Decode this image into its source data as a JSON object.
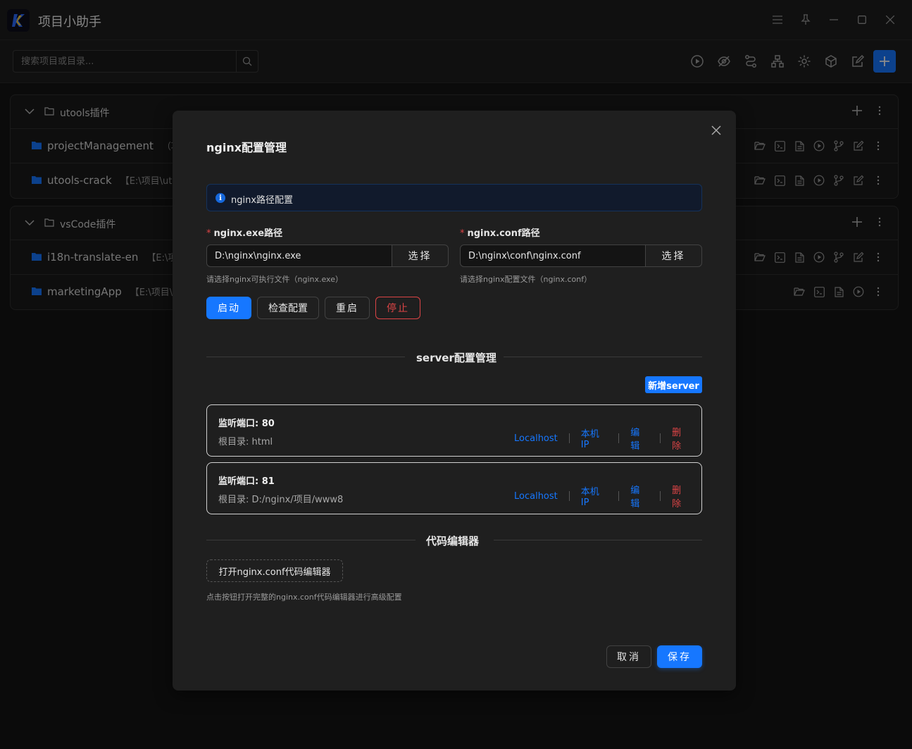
{
  "app": {
    "title": "项目小助手"
  },
  "search": {
    "placeholder": "搜索项目或目录..."
  },
  "groups": [
    {
      "name": "utools插件",
      "projects": [
        {
          "name": "projectManagement",
          "path": "（项"
        },
        {
          "name": "utools-crack",
          "path": "【E:\\项目\\uto"
        }
      ]
    },
    {
      "name": "vsCode插件",
      "projects": [
        {
          "name": "i18n-translate-en",
          "path": "【E:\\项目"
        },
        {
          "name": "marketingApp",
          "path": "【E:\\项目\\v"
        }
      ]
    }
  ],
  "modal": {
    "title": "nginx配置管理",
    "alert": "nginx路径配置",
    "exe": {
      "label": "nginx.exe路径",
      "value": "D:\\nginx\\nginx.exe",
      "button": "选择",
      "help": "请选择nginx可执行文件（nginx.exe）"
    },
    "conf": {
      "label": "nginx.conf路径",
      "value": "D:\\nginx\\conf\\nginx.conf",
      "button": "选择",
      "help": "请选择nginx配置文件（nginx.conf）"
    },
    "actions": {
      "start": "启动",
      "check": "检查配置",
      "restart": "重启",
      "stop": "停止"
    },
    "server_section": "server配置管理",
    "add_server": "新增server",
    "servers": [
      {
        "port": "监听端口: 80",
        "root": "根目录: html"
      },
      {
        "port": "监听端口: 81",
        "root": "根目录: D:/nginx/项目/www8"
      }
    ],
    "server_actions": {
      "localhost": "Localhost",
      "local_ip": "本机IP",
      "edit": "编辑",
      "delete": "删除"
    },
    "editor_section": "代码编辑器",
    "open_editor": "打开nginx.conf代码编辑器",
    "editor_help": "点击按钮打开完整的nginx.conf代码编辑器进行高级配置",
    "cancel": "取消",
    "save": "保存"
  },
  "colors": {
    "primary": "#1677ff",
    "danger": "#dc4446",
    "background": "#141414",
    "modal": "#1f1f1f"
  }
}
